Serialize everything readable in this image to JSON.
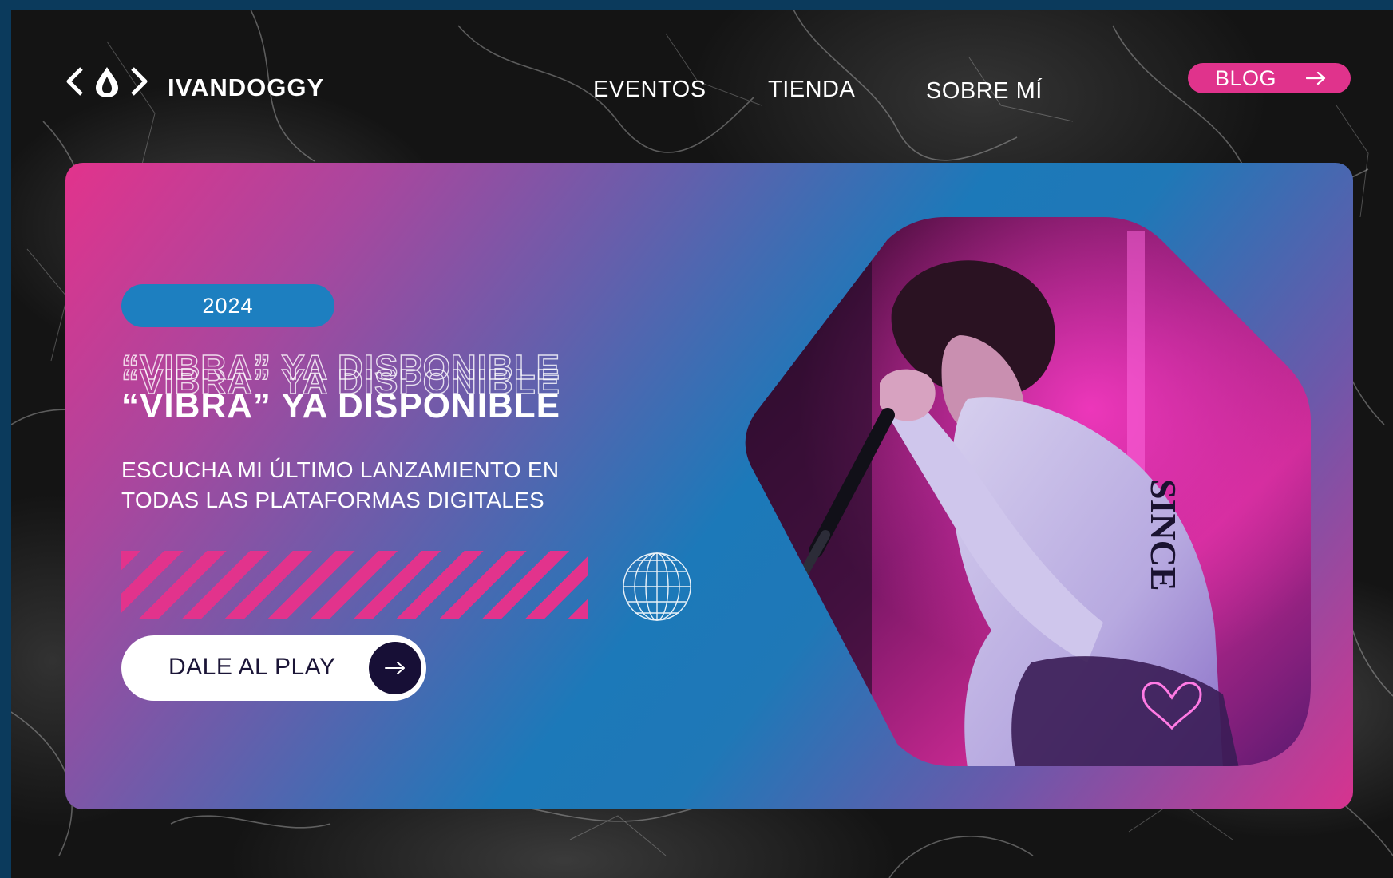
{
  "header": {
    "brand": "IVANDOGGY",
    "nav": [
      {
        "label": "EVENTOS"
      },
      {
        "label": "TIENDA"
      },
      {
        "label": "SOBRE MÍ"
      }
    ],
    "blog_button": {
      "label": "BLOG"
    }
  },
  "hero": {
    "year_badge": "2024",
    "title": "“VIBRA” YA DISPONIBLE",
    "subtitle_line1": "ESCUCHA MI ÚLTIMO LANZAMIENTO EN",
    "subtitle_line2": "TODAS LAS PLATAFORMAS DIGITALES",
    "cta_label": "DALE AL PLAY",
    "photo_sleeve_text": "SINCE"
  },
  "colors": {
    "accent_pink": "#e2338c",
    "accent_blue": "#1d7fc0",
    "dark_navy": "#170f36",
    "page_border": "#0b3a5c"
  },
  "icons": {
    "logo": "drop-brackets-icon",
    "blog_arrow": "arrow-right-icon",
    "globe": "globe-icon",
    "play_arrow": "arrow-right-icon"
  }
}
